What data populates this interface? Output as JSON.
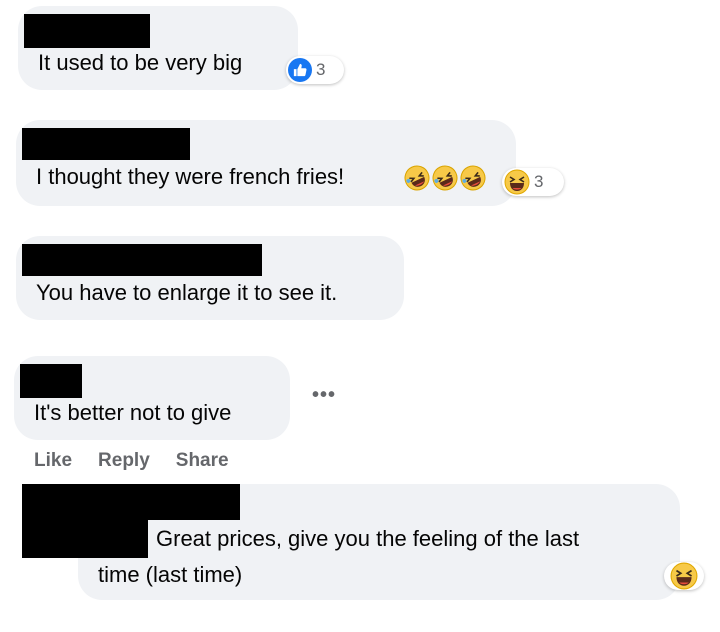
{
  "comments": [
    {
      "text": "It used to be very big",
      "reaction": {
        "type": "like",
        "icon": "thumbs-up-icon",
        "count": "3",
        "color": "#1877f2"
      }
    },
    {
      "text": "I thought they were french fries!",
      "inline_emojis": [
        "rolling-on-floor-laughing-icon",
        "rolling-on-floor-laughing-icon",
        "rolling-on-floor-laughing-icon"
      ],
      "reaction": {
        "type": "haha",
        "icon": "laughing-face-icon",
        "count": "3"
      }
    },
    {
      "text": "You have to enlarge it to see it."
    },
    {
      "text": "It's better not to give",
      "more_icon": "ellipsis-icon",
      "actions": {
        "like": "Like",
        "reply": "Reply",
        "share": "Share"
      }
    },
    {
      "text_line1": "Great prices, give you the feeling of the last",
      "text_line2": "time (last time)",
      "reaction": {
        "type": "haha",
        "icon": "laughing-face-icon"
      }
    }
  ],
  "colors": {
    "bubble": "#f0f2f5",
    "text": "#050505",
    "muted": "#65676b",
    "like_blue": "#1877f2",
    "emoji_yellow": "#f7c948"
  }
}
